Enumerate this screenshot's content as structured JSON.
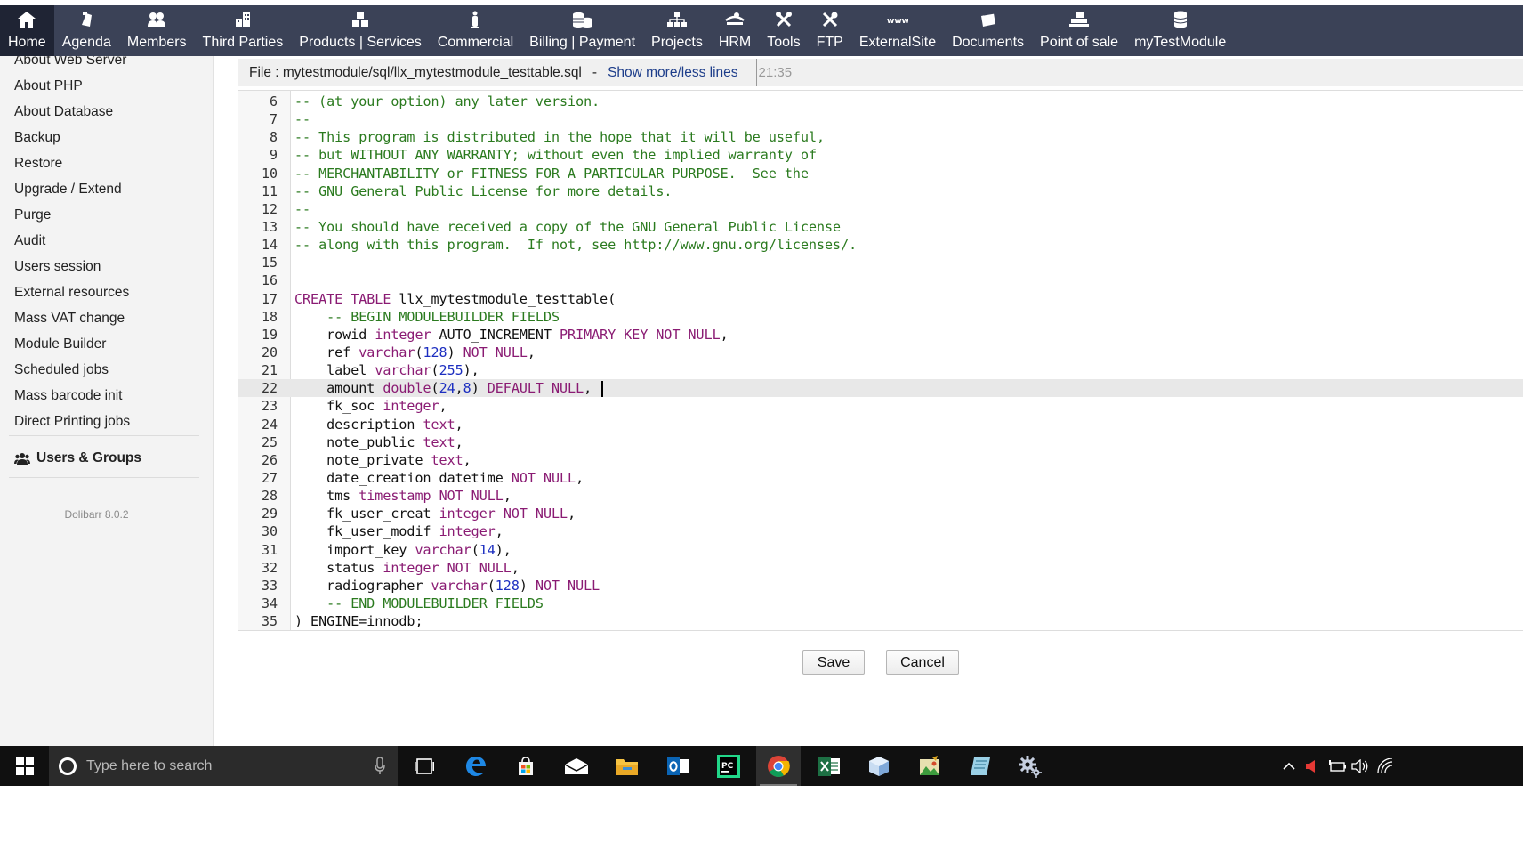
{
  "topnav": {
    "items": [
      {
        "label": "Home",
        "icon": "home-icon",
        "active": true
      },
      {
        "label": "Agenda",
        "icon": "agenda-icon"
      },
      {
        "label": "Members",
        "icon": "members-icon"
      },
      {
        "label": "Third Parties",
        "icon": "building-icon"
      },
      {
        "label": "Products | Services",
        "icon": "cubes-icon"
      },
      {
        "label": "Commercial",
        "icon": "suitcase-icon"
      },
      {
        "label": "Billing | Payment",
        "icon": "coins-icon"
      },
      {
        "label": "Projects",
        "icon": "sitemap-icon"
      },
      {
        "label": "HRM",
        "icon": "hrm-icon"
      },
      {
        "label": "Tools",
        "icon": "tools-icon"
      },
      {
        "label": "FTP",
        "icon": "ftp-icon"
      },
      {
        "label": "ExternalSite",
        "icon": "www-icon"
      },
      {
        "label": "Documents",
        "icon": "folder-icon"
      },
      {
        "label": "Point of sale",
        "icon": "cash-register-icon"
      },
      {
        "label": "myTestModule",
        "icon": "database-icon"
      }
    ]
  },
  "leftmenu": {
    "items": [
      "About Web Server",
      "About PHP",
      "About Database",
      "Backup",
      "Restore",
      "Upgrade / Extend",
      "Purge",
      "Audit",
      "Users session",
      "External resources",
      "Mass VAT change",
      "Module Builder",
      "Scheduled jobs",
      "Mass barcode init",
      "Direct Printing jobs"
    ],
    "group": "Users & Groups",
    "version": "Dolibarr 8.0.2"
  },
  "filebar": {
    "file": "File : mytestmodule/sql/llx_mytestmodule_testtable.sql",
    "separator": "-",
    "toggle_link": "Show more/less lines",
    "time": "21:35"
  },
  "editor": {
    "active_line": 22,
    "lines": [
      {
        "n": "6",
        "tokens": [
          {
            "t": "-- (at your option) any later version.",
            "c": "comment"
          }
        ]
      },
      {
        "n": "7",
        "tokens": [
          {
            "t": "--",
            "c": "comment"
          }
        ]
      },
      {
        "n": "8",
        "tokens": [
          {
            "t": "-- This program is distributed in the hope that it will be useful,",
            "c": "comment"
          }
        ]
      },
      {
        "n": "9",
        "tokens": [
          {
            "t": "-- but WITHOUT ANY WARRANTY; without even the implied warranty of",
            "c": "comment"
          }
        ]
      },
      {
        "n": "10",
        "tokens": [
          {
            "t": "-- MERCHANTABILITY or FITNESS FOR A PARTICULAR PURPOSE.  See the",
            "c": "comment"
          }
        ]
      },
      {
        "n": "11",
        "tokens": [
          {
            "t": "-- GNU General Public License for more details.",
            "c": "comment"
          }
        ]
      },
      {
        "n": "12",
        "tokens": [
          {
            "t": "--",
            "c": "comment"
          }
        ]
      },
      {
        "n": "13",
        "tokens": [
          {
            "t": "-- You should have received a copy of the GNU General Public License",
            "c": "comment"
          }
        ]
      },
      {
        "n": "14",
        "tokens": [
          {
            "t": "-- along with this program.  If not, see http://www.gnu.org/licenses/.",
            "c": "comment"
          }
        ]
      },
      {
        "n": "15",
        "tokens": []
      },
      {
        "n": "16",
        "tokens": []
      },
      {
        "n": "17",
        "tokens": [
          {
            "t": "CREATE",
            "c": "keyword"
          },
          {
            "t": " ",
            "c": "plain"
          },
          {
            "t": "TABLE",
            "c": "keyword"
          },
          {
            "t": " llx_mytestmodule_testtable(",
            "c": "plain"
          }
        ]
      },
      {
        "n": "18",
        "tokens": [
          {
            "t": "    ",
            "c": "plain"
          },
          {
            "t": "-- BEGIN MODULEBUILDER FIELDS",
            "c": "comment"
          }
        ]
      },
      {
        "n": "19",
        "tokens": [
          {
            "t": "    rowid ",
            "c": "plain"
          },
          {
            "t": "integer",
            "c": "type"
          },
          {
            "t": " AUTO_INCREMENT ",
            "c": "plain"
          },
          {
            "t": "PRIMARY KEY NOT NULL",
            "c": "keyword"
          },
          {
            "t": ",",
            "c": "plain"
          }
        ]
      },
      {
        "n": "20",
        "tokens": [
          {
            "t": "    ref ",
            "c": "plain"
          },
          {
            "t": "varchar",
            "c": "type"
          },
          {
            "t": "(",
            "c": "plain"
          },
          {
            "t": "128",
            "c": "number"
          },
          {
            "t": ") ",
            "c": "plain"
          },
          {
            "t": "NOT NULL",
            "c": "keyword"
          },
          {
            "t": ",",
            "c": "plain"
          }
        ]
      },
      {
        "n": "21",
        "tokens": [
          {
            "t": "    label ",
            "c": "plain"
          },
          {
            "t": "varchar",
            "c": "type"
          },
          {
            "t": "(",
            "c": "plain"
          },
          {
            "t": "255",
            "c": "number"
          },
          {
            "t": "),",
            "c": "plain"
          }
        ]
      },
      {
        "n": "22",
        "tokens": [
          {
            "t": "    amount ",
            "c": "plain"
          },
          {
            "t": "double",
            "c": "type"
          },
          {
            "t": "(",
            "c": "plain"
          },
          {
            "t": "24",
            "c": "number"
          },
          {
            "t": ",",
            "c": "plain"
          },
          {
            "t": "8",
            "c": "number"
          },
          {
            "t": ") ",
            "c": "plain"
          },
          {
            "t": "DEFAULT NULL",
            "c": "keyword"
          },
          {
            "t": ", ",
            "c": "plain"
          }
        ],
        "cursor": true
      },
      {
        "n": "23",
        "tokens": [
          {
            "t": "    fk_soc ",
            "c": "plain"
          },
          {
            "t": "integer",
            "c": "type"
          },
          {
            "t": ",",
            "c": "plain"
          }
        ]
      },
      {
        "n": "24",
        "tokens": [
          {
            "t": "    description ",
            "c": "plain"
          },
          {
            "t": "text",
            "c": "type"
          },
          {
            "t": ",",
            "c": "plain"
          }
        ]
      },
      {
        "n": "25",
        "tokens": [
          {
            "t": "    note_public ",
            "c": "plain"
          },
          {
            "t": "text",
            "c": "type"
          },
          {
            "t": ",",
            "c": "plain"
          }
        ]
      },
      {
        "n": "26",
        "tokens": [
          {
            "t": "    note_private ",
            "c": "plain"
          },
          {
            "t": "text",
            "c": "type"
          },
          {
            "t": ",",
            "c": "plain"
          }
        ]
      },
      {
        "n": "27",
        "tokens": [
          {
            "t": "    date_creation datetime ",
            "c": "plain"
          },
          {
            "t": "NOT NULL",
            "c": "keyword"
          },
          {
            "t": ",",
            "c": "plain"
          }
        ]
      },
      {
        "n": "28",
        "tokens": [
          {
            "t": "    tms ",
            "c": "plain"
          },
          {
            "t": "timestamp",
            "c": "type"
          },
          {
            "t": " ",
            "c": "plain"
          },
          {
            "t": "NOT NULL",
            "c": "keyword"
          },
          {
            "t": ",",
            "c": "plain"
          }
        ]
      },
      {
        "n": "29",
        "tokens": [
          {
            "t": "    fk_user_creat ",
            "c": "plain"
          },
          {
            "t": "integer",
            "c": "type"
          },
          {
            "t": " ",
            "c": "plain"
          },
          {
            "t": "NOT NULL",
            "c": "keyword"
          },
          {
            "t": ",",
            "c": "plain"
          }
        ]
      },
      {
        "n": "30",
        "tokens": [
          {
            "t": "    fk_user_modif ",
            "c": "plain"
          },
          {
            "t": "integer",
            "c": "type"
          },
          {
            "t": ",",
            "c": "plain"
          }
        ]
      },
      {
        "n": "31",
        "tokens": [
          {
            "t": "    import_key ",
            "c": "plain"
          },
          {
            "t": "varchar",
            "c": "type"
          },
          {
            "t": "(",
            "c": "plain"
          },
          {
            "t": "14",
            "c": "number"
          },
          {
            "t": "),",
            "c": "plain"
          }
        ]
      },
      {
        "n": "32",
        "tokens": [
          {
            "t": "    status ",
            "c": "plain"
          },
          {
            "t": "integer",
            "c": "type"
          },
          {
            "t": " ",
            "c": "plain"
          },
          {
            "t": "NOT NULL",
            "c": "keyword"
          },
          {
            "t": ",",
            "c": "plain"
          }
        ]
      },
      {
        "n": "33",
        "tokens": [
          {
            "t": "    radiographer ",
            "c": "plain"
          },
          {
            "t": "varchar",
            "c": "type"
          },
          {
            "t": "(",
            "c": "plain"
          },
          {
            "t": "128",
            "c": "number"
          },
          {
            "t": ") ",
            "c": "plain"
          },
          {
            "t": "NOT NULL",
            "c": "keyword"
          }
        ]
      },
      {
        "n": "34",
        "tokens": [
          {
            "t": "    ",
            "c": "plain"
          },
          {
            "t": "-- END MODULEBUILDER FIELDS",
            "c": "comment"
          }
        ]
      },
      {
        "n": "35",
        "tokens": [
          {
            "t": ") ENGINE=innodb;",
            "c": "plain"
          }
        ]
      }
    ]
  },
  "buttons": {
    "save": "Save",
    "cancel": "Cancel"
  },
  "taskbar": {
    "search_placeholder": "Type here to search",
    "apps": [
      "task-view-icon",
      "edge-icon",
      "store-icon",
      "mail-icon",
      "file-explorer-icon",
      "outlook-icon",
      "pycharm-icon",
      "chrome-icon",
      "excel-icon",
      "cube-app-icon",
      "image-editor-icon",
      "notepad-icon",
      "settings-icon"
    ],
    "tray": [
      "chevron-up-icon",
      "speaker-muted-icon",
      "battery-icon",
      "volume-icon",
      "wifi-icon"
    ]
  },
  "colors": {
    "nav_bg": "#3b4257",
    "nav_active": "#1f2434",
    "comment": "#2a7a1e",
    "keyword": "#8a1b73",
    "number": "#1c2ec0",
    "link": "#1d3d8a"
  }
}
